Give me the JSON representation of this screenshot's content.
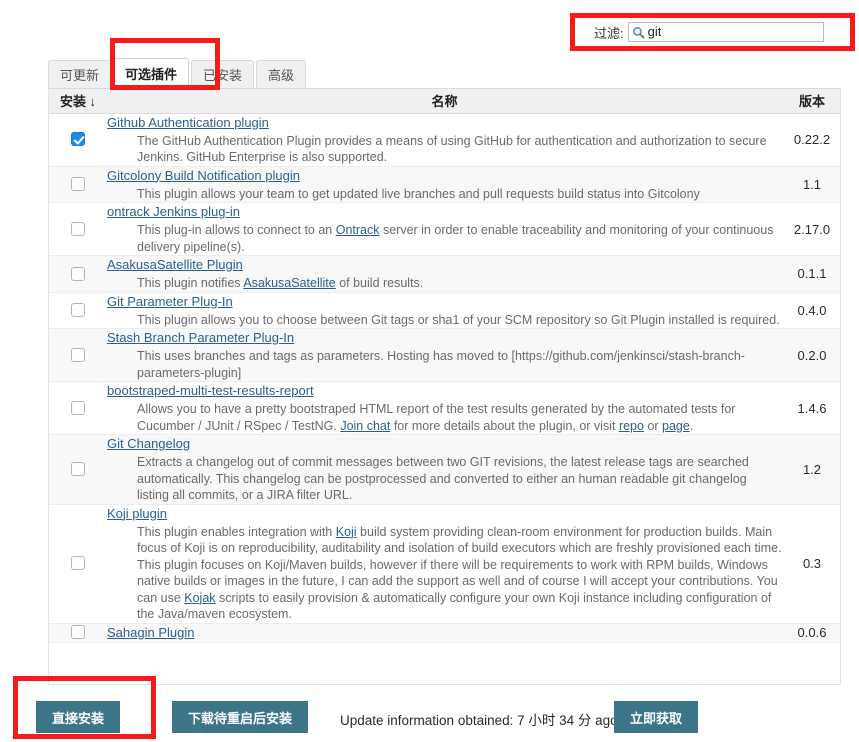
{
  "filter": {
    "label": "过滤:",
    "value": "git",
    "placeholder": "",
    "icon": "search-icon"
  },
  "tabs": [
    {
      "label": "可更新",
      "active": false
    },
    {
      "label": "可选插件",
      "active": true
    },
    {
      "label": "已安装",
      "active": false
    },
    {
      "label": "高级",
      "active": false
    }
  ],
  "table": {
    "headers": {
      "install": "安装 ↓",
      "name": "名称",
      "version": "版本"
    },
    "rows": [
      {
        "checked": true,
        "title": "Github Authentication plugin",
        "desc_parts": [
          {
            "t": "The GitHub Authentication Plugin provides a means of using GitHub for authentication and authorization to secure Jenkins. GitHub Enterprise is also supported.",
            "link": false
          }
        ],
        "version": "0.22.2"
      },
      {
        "checked": false,
        "title": "Gitcolony Build Notification plugin",
        "desc_parts": [
          {
            "t": "This plugin allows your team to get updated live branches and pull requests build status into Gitcolony",
            "link": false
          }
        ],
        "version": "1.1"
      },
      {
        "checked": false,
        "title": "ontrack Jenkins plug-in",
        "desc_parts": [
          {
            "t": "This plug-in allows to connect to an ",
            "link": false
          },
          {
            "t": "Ontrack",
            "link": true
          },
          {
            "t": " server in order to enable traceability and monitoring of your continuous delivery pipeline(s).",
            "link": false
          }
        ],
        "version": "2.17.0"
      },
      {
        "checked": false,
        "title": "AsakusaSatellite Plugin",
        "desc_parts": [
          {
            "t": "This plugin notifies ",
            "link": false
          },
          {
            "t": "AsakusaSatellite",
            "link": true
          },
          {
            "t": " of build results.",
            "link": false
          }
        ],
        "version": "0.1.1"
      },
      {
        "checked": false,
        "title": "Git Parameter Plug-In",
        "desc_parts": [
          {
            "t": "This plugin allows you to choose between Git tags or sha1 of your SCM repository so Git Plugin installed is required.",
            "link": false
          }
        ],
        "version": "0.4.0"
      },
      {
        "checked": false,
        "title": "Stash Branch Parameter Plug-In",
        "desc_parts": [
          {
            "t": "This uses branches and tags as parameters. Hosting has moved to [https://github.com/jenkinsci/stash-branch-parameters-plugin]",
            "link": false
          }
        ],
        "version": "0.2.0"
      },
      {
        "checked": false,
        "title": "bootstraped-multi-test-results-report",
        "desc_parts": [
          {
            "t": "Allows you to have a pretty bootstraped HTML report of the test results generated by the automated tests for Cucumber / JUnit / RSpec / TestNG. ",
            "link": false
          },
          {
            "t": "Join chat",
            "link": true
          },
          {
            "t": " for more details about the plugin, or visit ",
            "link": false
          },
          {
            "t": "repo",
            "link": true
          },
          {
            "t": " or ",
            "link": false
          },
          {
            "t": "page",
            "link": true
          },
          {
            "t": ".",
            "link": false
          }
        ],
        "version": "1.4.6"
      },
      {
        "checked": false,
        "title": "Git Changelog",
        "desc_parts": [
          {
            "t": "Extracts a changelog out of commit messages between two GIT revisions, the latest release tags are searched automatically. This changelog can be postprocessed and converted to either an human readable git changelog listing all commits, or a JIRA filter URL.",
            "link": false
          }
        ],
        "version": "1.2"
      },
      {
        "checked": false,
        "title": "Koji plugin",
        "desc_parts": [
          {
            "t": "This plugin enables integration with ",
            "link": false
          },
          {
            "t": "Koji",
            "link": true
          },
          {
            "t": " build system providing clean-room environment for production builds. Main focus of Koji is on reproducibility, auditability and isolation of build executors which are freshly provisioned each time. This plugin focuses on Koji/Maven builds, however if there will be requirements to work with RPM builds, Windows native builds or images in the future, I can add the support as well and of course I will accept your contributions. You can use ",
            "link": false
          },
          {
            "t": "Kojak",
            "link": true
          },
          {
            "t": " scripts to easily provision & automatically configure your own Koji instance including configuration of the Java/maven ecosystem.",
            "link": false
          }
        ],
        "version": "0.3"
      },
      {
        "checked": false,
        "title": "Sahagin Plugin",
        "desc_parts": [],
        "version": "0.0.6"
      }
    ]
  },
  "footer": {
    "install_now": "直接安装",
    "download_restart": "下载待重启后安装",
    "check_now": "立即获取",
    "update_status": "Update information obtained: 7 小时 34 分 ago"
  },
  "annotations": {
    "accent": "#f61a1a"
  }
}
